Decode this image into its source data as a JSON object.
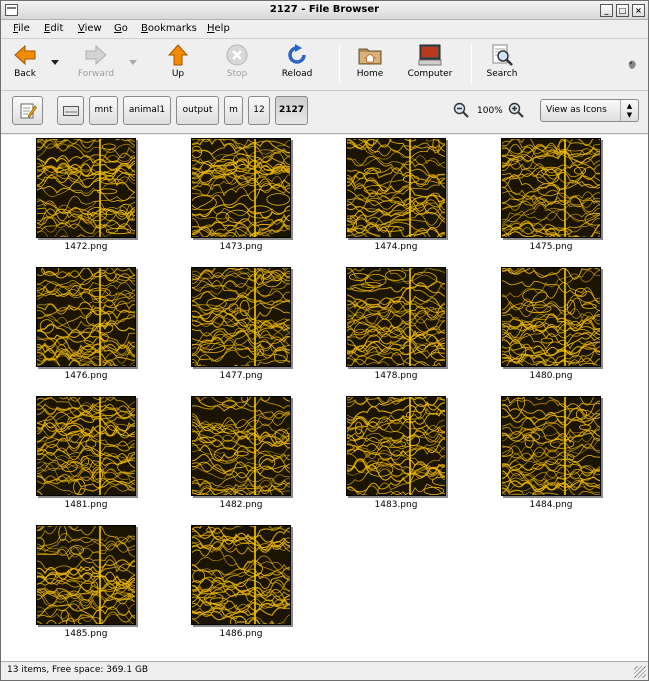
{
  "window": {
    "title": "2127 - File Browser"
  },
  "menubar": {
    "items": [
      "File",
      "Edit",
      "View",
      "Go",
      "Bookmarks",
      "Help"
    ]
  },
  "toolbar": {
    "back": "Back",
    "forward": "Forward",
    "up": "Up",
    "stop": "Stop",
    "reload": "Reload",
    "home": "Home",
    "computer": "Computer",
    "search": "Search"
  },
  "location": {
    "path": [
      "mnt",
      "animal1",
      "output",
      "m",
      "12",
      "2127"
    ],
    "zoom": "100%",
    "view_mode": "View as Icons"
  },
  "files": [
    "1472.png",
    "1473.png",
    "1474.png",
    "1475.png",
    "1476.png",
    "1477.png",
    "1478.png",
    "1480.png",
    "1481.png",
    "1482.png",
    "1483.png",
    "1484.png",
    "1485.png",
    "1486.png"
  ],
  "status": {
    "text": "13 items, Free space: 369.1 GB"
  },
  "colors": {
    "thumb_line": "#e8b400",
    "thumb_bg": "#1a1400",
    "thumb_divider": "#f5c800"
  }
}
